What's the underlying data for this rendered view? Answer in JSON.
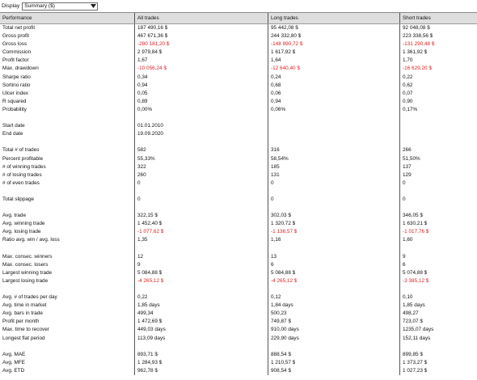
{
  "toolbar": {
    "display_label": "Display",
    "display_value": "Summary ($)"
  },
  "headers": [
    "Performance",
    "All trades",
    "Long trades",
    "Short trades"
  ],
  "colors": {
    "negative": "#e02020",
    "header_bg": "#dedede"
  },
  "rows": [
    {
      "label": "Total net profit",
      "all": "187 490,16 $",
      "long": "95 442,08 $",
      "short": "92 048,08 $"
    },
    {
      "label": "Gross profit",
      "all": "467 671,36 $",
      "long": "244 332,80 $",
      "short": "223 338,56 $"
    },
    {
      "label": "Gross loss",
      "all": "-280 181,20 $",
      "long": "-148 890,72 $",
      "short": "-131 290,48 $",
      "neg": true
    },
    {
      "label": "Commission",
      "all": "2 979,84 $",
      "long": "1 617,92 $",
      "short": "1 361,92 $"
    },
    {
      "label": "Profit factor",
      "all": "1,67",
      "long": "1,64",
      "short": "1,70"
    },
    {
      "label": "Max. drawdown",
      "all": "-10 056,24 $",
      "long": "-12 640,40 $",
      "short": "-16 629,20 $",
      "neg": true
    },
    {
      "label": "Sharpe ratio",
      "all": "0,34",
      "long": "0,24",
      "short": "0,22"
    },
    {
      "label": "Sortino ratio",
      "all": "0,94",
      "long": "0,68",
      "short": "0,62"
    },
    {
      "label": "Ulcer index",
      "all": "0,05",
      "long": "0,06",
      "short": "0,07"
    },
    {
      "label": "R squared",
      "all": "0,89",
      "long": "0,94",
      "short": "0,90"
    },
    {
      "label": "Probability",
      "all": "0,00%",
      "long": "0,06%",
      "short": "0,17%"
    },
    {
      "label": "",
      "all": "",
      "long": "",
      "short": ""
    },
    {
      "label": "Start date",
      "all": "01.01.2010",
      "long": "",
      "short": ""
    },
    {
      "label": "End date",
      "all": "19.09.2020",
      "long": "",
      "short": ""
    },
    {
      "label": "",
      "all": "",
      "long": "",
      "short": ""
    },
    {
      "label": "Total # of trades",
      "all": "582",
      "long": "316",
      "short": "266"
    },
    {
      "label": "Percent profitable",
      "all": "55,33%",
      "long": "58,54%",
      "short": "51,50%"
    },
    {
      "label": "# of winning trades",
      "all": "322",
      "long": "185",
      "short": "137"
    },
    {
      "label": "# of losing trades",
      "all": "260",
      "long": "131",
      "short": "129"
    },
    {
      "label": "# of even trades",
      "all": "0",
      "long": "0",
      "short": "0"
    },
    {
      "label": "",
      "all": "",
      "long": "",
      "short": ""
    },
    {
      "label": "Total slippage",
      "all": "0",
      "long": "0",
      "short": "0"
    },
    {
      "label": "",
      "all": "",
      "long": "",
      "short": ""
    },
    {
      "label": "Avg. trade",
      "all": "322,15 $",
      "long": "302,03 $",
      "short": "346,05 $"
    },
    {
      "label": "Avg. winning trade",
      "all": "1 452,40 $",
      "long": "1 320,72 $",
      "short": "1 630,21 $"
    },
    {
      "label": "Avg. losing trade",
      "all": "-1 077,62 $",
      "long": "-1 136,57 $",
      "short": "-1 017,76 $",
      "neg": true
    },
    {
      "label": "Ratio avg. win / avg. loss",
      "all": "1,35",
      "long": "1,16",
      "short": "1,60"
    },
    {
      "label": "",
      "all": "",
      "long": "",
      "short": ""
    },
    {
      "label": "Max. consec. winners",
      "all": "12",
      "long": "13",
      "short": "9"
    },
    {
      "label": "Max. consec. losers",
      "all": "9",
      "long": "6",
      "short": "6"
    },
    {
      "label": "Largest winning trade",
      "all": "5 084,88 $",
      "long": "5 084,88 $",
      "short": "5 074,88 $"
    },
    {
      "label": "Largest losing trade",
      "all": "-4 265,12 $",
      "long": "-4 265,12 $",
      "short": "-3 385,12 $",
      "neg": true
    },
    {
      "label": "",
      "all": "",
      "long": "",
      "short": ""
    },
    {
      "label": "Avg. # of trades per day",
      "all": "0,22",
      "long": "0,12",
      "short": "0,10"
    },
    {
      "label": "Avg. time in market",
      "all": "1,85 days",
      "long": "1,84 days",
      "short": "1,85 days"
    },
    {
      "label": "Avg. bars in trade",
      "all": "499,34",
      "long": "500,23",
      "short": "498,27"
    },
    {
      "label": "Profit per month",
      "all": "1 472,69 $",
      "long": "749,87 $",
      "short": "723,07 $"
    },
    {
      "label": "Max. time to recover",
      "all": "449,03 days",
      "long": "910,00 days",
      "short": "1235,07 days"
    },
    {
      "label": "Longest flat period",
      "all": "113,09 days",
      "long": "229,90 days",
      "short": "152,11 days"
    },
    {
      "label": "",
      "all": "",
      "long": "",
      "short": ""
    },
    {
      "label": "Avg. MAE",
      "all": "893,71 $",
      "long": "888,54 $",
      "short": "899,85 $"
    },
    {
      "label": "Avg. MFE",
      "all": "1 284,93 $",
      "long": "1 210,57 $",
      "short": "1 373,27 $"
    },
    {
      "label": "Avg. ETD",
      "all": "962,78 $",
      "long": "908,54 $",
      "short": "1 027,23 $"
    }
  ]
}
